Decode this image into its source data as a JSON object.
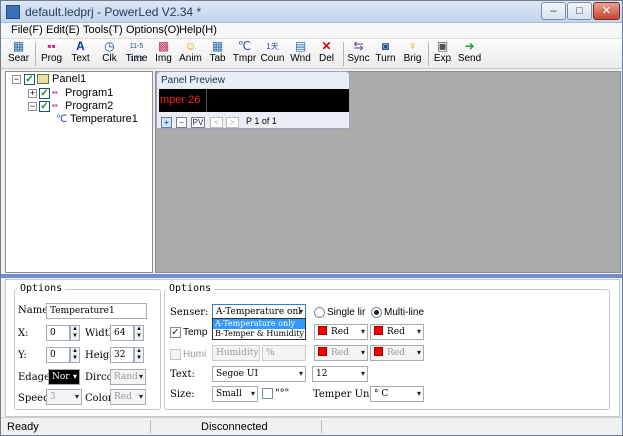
{
  "window": {
    "title": "default.ledprj - PowerLed V2.34 *",
    "minimize_label": "–",
    "maximize_label": "□",
    "close_label": "✕"
  },
  "menu": [
    "File(F)",
    "Edit(E)",
    "Tools(T)",
    "Options(O)",
    "Help(H)"
  ],
  "toolbar": [
    {
      "label": "Sear",
      "icon": "search-icon"
    },
    {
      "label": "Prog",
      "icon": "program-icon"
    },
    {
      "label": "Text",
      "icon": "text-icon"
    },
    {
      "label": "Clk",
      "icon": "clock-icon"
    },
    {
      "label": "Time",
      "icon": "time-icon"
    },
    {
      "label": "Img",
      "icon": "image-icon"
    },
    {
      "label": "Anim",
      "icon": "smiley-icon"
    },
    {
      "label": "Tab",
      "icon": "table-icon"
    },
    {
      "label": "Tmpr",
      "icon": "temperature-icon"
    },
    {
      "label": "Coun",
      "icon": "counter-icon"
    },
    {
      "label": "Wnd",
      "icon": "window-icon"
    },
    {
      "label": "Del",
      "icon": "delete-icon"
    },
    {
      "label": "Sync",
      "icon": "sync-icon"
    },
    {
      "label": "Turn",
      "icon": "turn-icon"
    },
    {
      "label": "Brig",
      "icon": "bulb-icon"
    },
    {
      "label": "Exp",
      "icon": "export-icon"
    },
    {
      "label": "Send",
      "icon": "send-icon"
    }
  ],
  "tree": {
    "panel": "Panel1",
    "program1": "Program1",
    "program2": "Program2",
    "temperature": "Temperature1"
  },
  "preview": {
    "title": "Panel Preview",
    "led_text": "mper 26",
    "plus": "+",
    "minus": "−",
    "pv": "PV",
    "prev": "<",
    "next": ">",
    "page": "P 1 of 1"
  },
  "options_left": {
    "group_label": "Options",
    "name_label": "Name:",
    "name_value": "Temperature1",
    "x_label": "X:",
    "x_value": "0",
    "width_label": "Width",
    "width_value": "64",
    "y_label": "Y:",
    "y_value": "0",
    "height_label": "Heigh",
    "height_value": "32",
    "edge_label": "Edage",
    "edge_value": "Nor",
    "direction_label": "Dircc",
    "direction_value": "Rand",
    "speed_label": "Speed",
    "speed_value": "3",
    "color_label": "Color",
    "color_value": "Red"
  },
  "options_right": {
    "group_label": "Options",
    "sensor_label": "Senser:",
    "sensor_value": "A-Temperature onl",
    "sensor_options": [
      "A-Temperature only",
      "B-Temper & Humidity"
    ],
    "single_line_label": "Single lir",
    "multi_line_label": "Multi-line",
    "temp_label": "Temp",
    "temp_checked": true,
    "humi_label": "Humi",
    "humidity_value": "Humidity",
    "percent_value": "%",
    "color1": "Red",
    "color2": "Red",
    "color3": "Red",
    "color4": "Red",
    "text_label": "Text:",
    "font_value": "Segoe UI",
    "font_size_value": "12",
    "size_label": "Size:",
    "size_value": "Small",
    "degree_label": "\"°\"",
    "unit_label": "Temper Unit:",
    "unit_value": "° C"
  },
  "status": {
    "left": "Ready",
    "center": "Disconnected"
  },
  "colors": {
    "led_text": "#ff2020",
    "red_swatch": "#ff0000",
    "splitter": "#6f8fd0",
    "workarea": "#ababab"
  }
}
